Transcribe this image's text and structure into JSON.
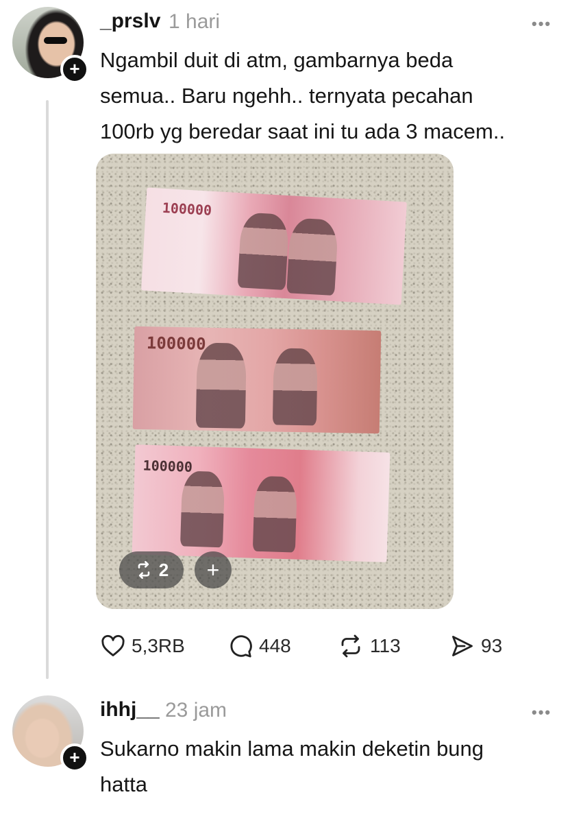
{
  "posts": [
    {
      "username": "_prslv",
      "time": "1 hari",
      "text": "Ngambil duit di atm, gambarnya beda\nsemua.. Baru ngehh.. ternyata pecahan\n100rb yg beredar saat ini tu ada 3 macem..",
      "photo": {
        "note_labels": [
          "100000",
          "100000",
          "100000"
        ],
        "repost_count": "2",
        "add_label": "+"
      },
      "actions": {
        "likes": "5,3RB",
        "replies": "448",
        "reposts": "113",
        "shares": "93"
      }
    },
    {
      "username": "ihhj__",
      "time": "23 jam",
      "text": "Sukarno makin lama makin deketin bung\nhatta"
    }
  ],
  "badge_plus": "+",
  "more_glyph": "•••",
  "icons": [
    "heart-icon",
    "comment-icon",
    "repost-icon",
    "share-icon",
    "more-icon",
    "follow-plus-icon"
  ]
}
